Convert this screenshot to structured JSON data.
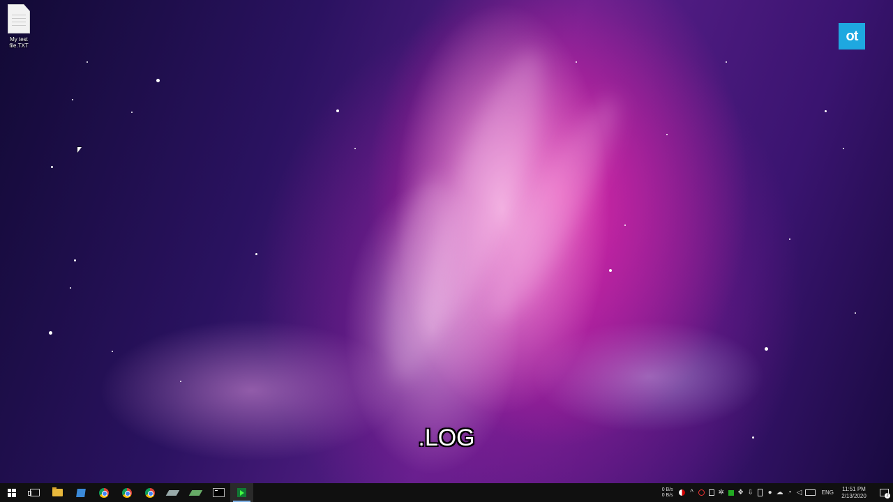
{
  "desktop": {
    "icons": [
      {
        "label_line1": "My test",
        "label_line2": "file.TXT",
        "icon": "text-file-icon"
      }
    ],
    "brand_logo": "ot",
    "caption": ".LOG"
  },
  "taskbar": {
    "apps": [
      {
        "name": "start",
        "icon": "windows-start-icon"
      },
      {
        "name": "task-view",
        "icon": "task-view-icon"
      },
      {
        "name": "file-explorer",
        "icon": "folder-icon"
      },
      {
        "name": "store",
        "icon": "store-icon"
      },
      {
        "name": "chrome-1",
        "icon": "chrome-icon"
      },
      {
        "name": "chrome-2",
        "icon": "chrome-icon"
      },
      {
        "name": "chrome-3",
        "icon": "chrome-icon"
      },
      {
        "name": "app-stack-1",
        "icon": "stack-icon"
      },
      {
        "name": "app-stack-2",
        "icon": "stack-icon"
      },
      {
        "name": "terminal",
        "icon": "terminal-icon"
      },
      {
        "name": "active-app",
        "icon": "arrow-app-icon"
      }
    ],
    "tray": {
      "net_up": "0 B/s",
      "net_down": "0 B/s",
      "language": "ENG",
      "time": "11:51 PM",
      "date": "2/13/2020",
      "notification_count": "2"
    }
  },
  "colors": {
    "brand": "#1ea8e0",
    "taskbar": "#101010",
    "active_indicator": "#7fb3e8"
  }
}
